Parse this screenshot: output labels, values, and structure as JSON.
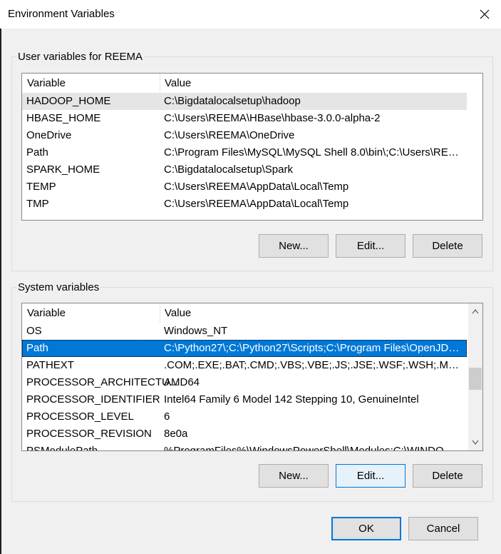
{
  "window": {
    "title": "Environment Variables"
  },
  "user_vars": {
    "group_label": "User variables for REEMA",
    "columns": [
      "Variable",
      "Value"
    ],
    "rows": [
      {
        "name": "HADOOP_HOME",
        "value": "C:\\Bigdatalocalsetup\\hadoop"
      },
      {
        "name": "HBASE_HOME",
        "value": "C:\\Users\\REEMA\\HBase\\hbase-3.0.0-alpha-2"
      },
      {
        "name": "OneDrive",
        "value": "C:\\Users\\REEMA\\OneDrive"
      },
      {
        "name": "Path",
        "value": "C:\\Program Files\\MySQL\\MySQL Shell 8.0\\bin\\;C:\\Users\\REEM..."
      },
      {
        "name": "SPARK_HOME",
        "value": "C:\\Bigdatalocalsetup\\Spark"
      },
      {
        "name": "TEMP",
        "value": "C:\\Users\\REEMA\\AppData\\Local\\Temp"
      },
      {
        "name": "TMP",
        "value": "C:\\Users\\REEMA\\AppData\\Local\\Temp"
      }
    ],
    "buttons": {
      "new": "New...",
      "edit": "Edit...",
      "delete": "Delete"
    }
  },
  "system_vars": {
    "group_label": "System variables",
    "columns": [
      "Variable",
      "Value"
    ],
    "rows": [
      {
        "name": "OS",
        "value": "Windows_NT"
      },
      {
        "name": "Path",
        "value": "C:\\Python27\\;C:\\Python27\\Scripts;C:\\Program Files\\OpenJDK\\j..."
      },
      {
        "name": "PATHEXT",
        "value": ".COM;.EXE;.BAT;.CMD;.VBS;.VBE;.JS;.JSE;.WSF;.WSH;.MSC"
      },
      {
        "name": "PROCESSOR_ARCHITECTU...",
        "value": "AMD64"
      },
      {
        "name": "PROCESSOR_IDENTIFIER",
        "value": "Intel64 Family 6 Model 142 Stepping 10, GenuineIntel"
      },
      {
        "name": "PROCESSOR_LEVEL",
        "value": "6"
      },
      {
        "name": "PROCESSOR_REVISION",
        "value": "8e0a"
      },
      {
        "name": "PSModulePath",
        "value": "%ProgramFiles%\\WindowsPowerShell\\Modules;C:\\WINDOWS..."
      }
    ],
    "buttons": {
      "new": "New...",
      "edit": "Edit...",
      "delete": "Delete"
    }
  },
  "footer": {
    "ok": "OK",
    "cancel": "Cancel"
  },
  "icons": {
    "close": "close-icon",
    "scroll_up": "chevron-up-icon",
    "scroll_down": "chevron-down-icon"
  }
}
